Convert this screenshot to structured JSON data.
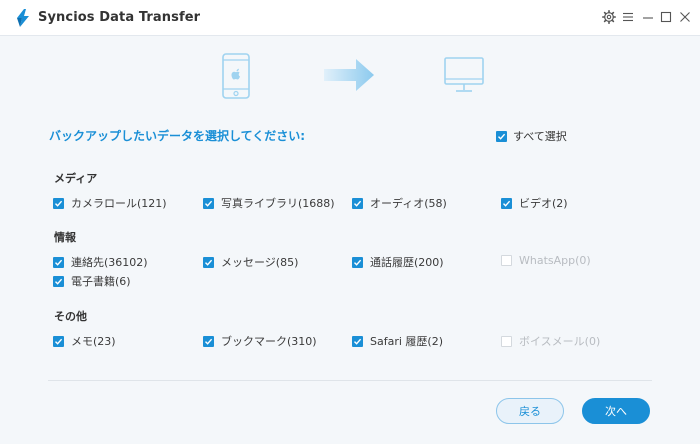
{
  "app": {
    "title": "Syncios Data Transfer"
  },
  "colors": {
    "accent": "#1a8fd6",
    "icon_light": "#9fd3f0",
    "disabled": "#b8bcc1"
  },
  "transfer": {
    "source_icon": "iphone-apple-icon",
    "direction_icon": "arrow-right-icon",
    "target_icon": "monitor-icon"
  },
  "prompt": "バックアップしたいデータを選択してください:",
  "select_all": {
    "label": "すべて選択",
    "checked": true
  },
  "sections": {
    "media": {
      "title": "メディア",
      "items": [
        {
          "label": "カメラロール(121)",
          "checked": true,
          "enabled": true
        },
        {
          "label": "写真ライブラリ(1688)",
          "checked": true,
          "enabled": true
        },
        {
          "label": "オーディオ(58)",
          "checked": true,
          "enabled": true
        },
        {
          "label": "ビデオ(2)",
          "checked": true,
          "enabled": true
        }
      ]
    },
    "info": {
      "title": "情報",
      "items": [
        {
          "label": "連絡先(36102)",
          "checked": true,
          "enabled": true
        },
        {
          "label": "メッセージ(85)",
          "checked": true,
          "enabled": true
        },
        {
          "label": "通話履歴(200)",
          "checked": true,
          "enabled": true
        },
        {
          "label": "WhatsApp(0)",
          "checked": false,
          "enabled": false
        },
        {
          "label": "電子書籍(6)",
          "checked": true,
          "enabled": true
        }
      ]
    },
    "other": {
      "title": "その他",
      "items": [
        {
          "label": "メモ(23)",
          "checked": true,
          "enabled": true
        },
        {
          "label": "ブックマーク(310)",
          "checked": true,
          "enabled": true
        },
        {
          "label": "Safari 履歴(2)",
          "checked": true,
          "enabled": true
        },
        {
          "label": "ボイスメール(0)",
          "checked": false,
          "enabled": false
        }
      ]
    }
  },
  "buttons": {
    "back": "戻る",
    "next": "次へ"
  }
}
